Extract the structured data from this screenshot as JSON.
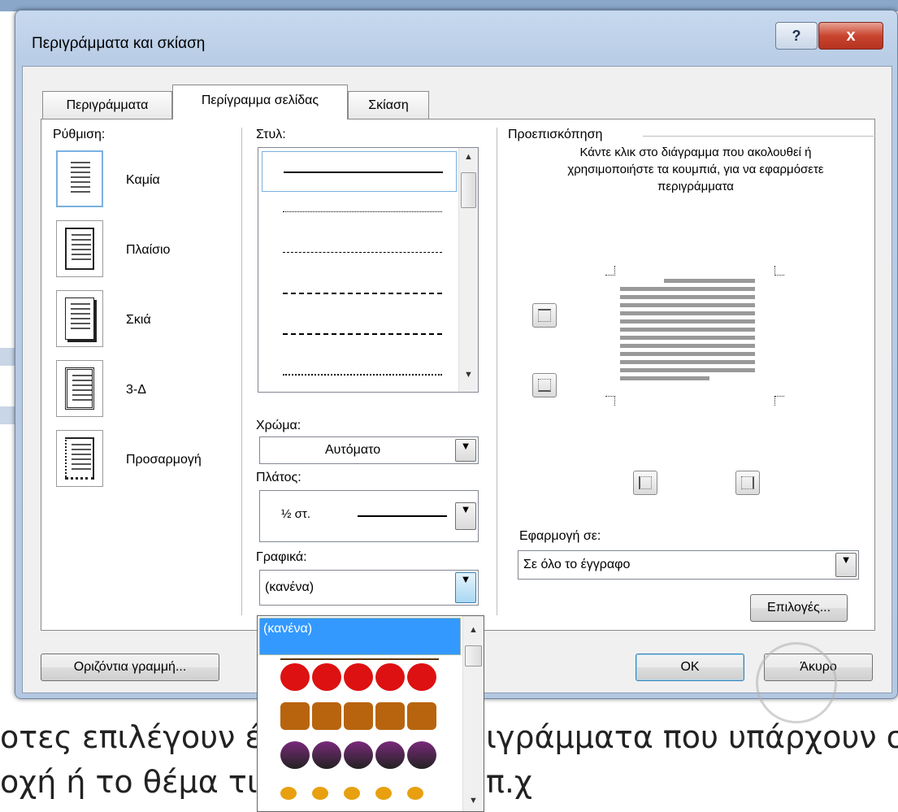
{
  "background": {
    "line1": "οτες επιλέγουν έ",
    "line1b": "ιγράμματα που υπάρχουν σ",
    "line2": "οχή ή το θέμα τι",
    "line2b": "π.χ"
  },
  "dialog": {
    "title": "Περιγράμματα και σκίαση",
    "help": "?",
    "close": "x"
  },
  "tabs": [
    {
      "label": "Περιγράμματα"
    },
    {
      "label": "Περίγραμμα σελίδας"
    },
    {
      "label": "Σκίαση"
    }
  ],
  "setting": {
    "label": "Ρύθμιση:",
    "options": [
      {
        "label": "Καμία"
      },
      {
        "label": "Πλαίσιο"
      },
      {
        "label": "Σκιά"
      },
      {
        "label": "3-Δ"
      },
      {
        "label": "Προσαρμογή"
      }
    ]
  },
  "style": {
    "label": "Στυλ:"
  },
  "color": {
    "label": "Χρώμα:",
    "value": "Αυτόματο"
  },
  "width": {
    "label": "Πλάτος:",
    "value": "½ στ."
  },
  "art": {
    "label": "Γραφικά:",
    "value": "(κανένα)",
    "list_selected": "(κανένα)"
  },
  "preview": {
    "label": "Προεπισκόπηση",
    "instructions": "Κάντε κλικ στο διάγραμμα που ακολουθεί ή χρησιμοποιήστε τα κουμπιά, για να εφαρμόσετε περιγράμματα"
  },
  "apply_to": {
    "label": "Εφαρμογή σε:",
    "value": "Σε όλο το έγγραφο"
  },
  "buttons": {
    "options": "Επιλογές...",
    "horizontal_line": "Οριζόντια γραμμή...",
    "ok": "OK",
    "cancel": "Άκυρο"
  },
  "colors": {
    "selection": "#3399ff",
    "accent": "#7ab0e0",
    "close_red": "#c9452f"
  }
}
